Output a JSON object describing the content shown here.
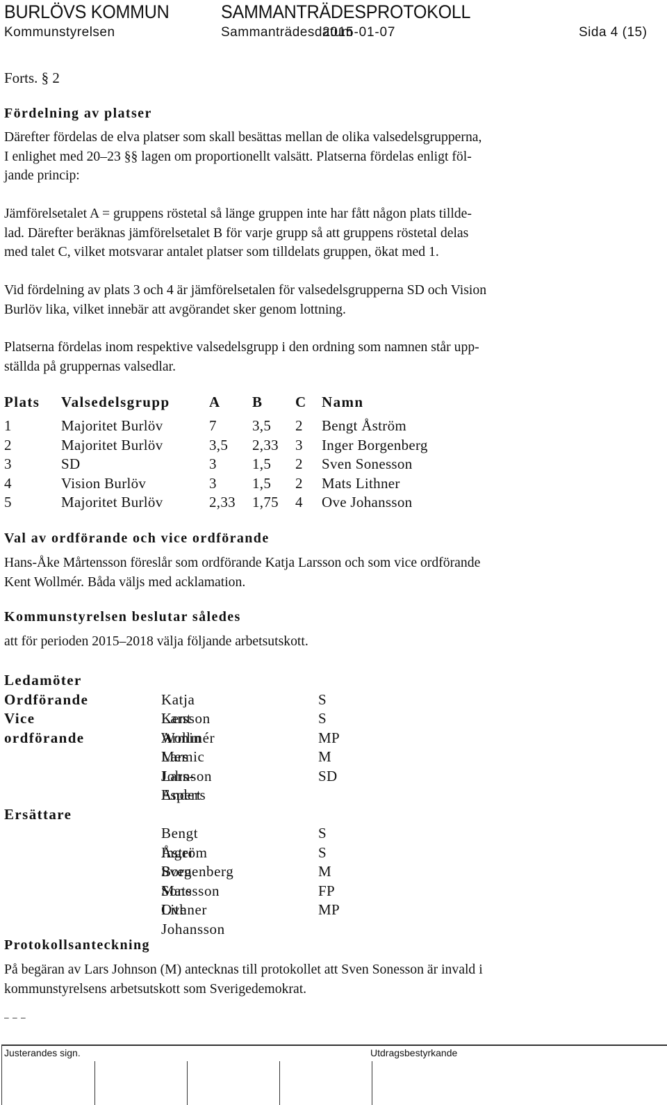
{
  "header": {
    "organization": "BURLÖVS KOMMUN",
    "document_type": "SAMMANTRÄDESPROTOKOLL",
    "body": "Kommunstyrelsen",
    "date_label": "Sammanträdesdatum",
    "date": "2015-01-07",
    "page": "Sida 4 (15)"
  },
  "continuation": "Forts. § 2",
  "sections": {
    "distribution": {
      "heading": "Fördelning av platser",
      "para1_lines": [
        "Därefter fördelas de elva platser som skall besättas mellan de olika valsedelsgrupperna,",
        "I enlighet med 20–23 §§ lagen om proportionellt valsätt. Platserna fördelas enligt föl-",
        "jande princip:"
      ],
      "para2_lines": [
        "Jämförelsetalet A = gruppens röstetal så länge gruppen inte har fått någon plats tillde-",
        "lad. Därefter beräknas jämförelsetalet B för varje grupp så att gruppens röstetal delas",
        "med talet C, vilket motsvarar antalet platser som tilldelats gruppen, ökat med 1."
      ],
      "para3_lines": [
        "Vid fördelning av plats 3 och 4 är jämförelsetalen för valsedelsgrupperna SD och Vision",
        "Burlöv lika, vilket innebär att avgörandet sker genom lottning."
      ],
      "para4_lines": [
        "Platserna fördelas inom respektive valsedelsgrupp i den ordning som namnen står upp-",
        "ställda på gruppernas valsedlar."
      ]
    },
    "seat_table": {
      "columns": [
        "Plats",
        "Valsedelsgrupp",
        "A",
        "B",
        "C",
        "Namn"
      ],
      "rows": [
        [
          "1",
          "Majoritet Burlöv",
          "7",
          "3,5",
          "2",
          "Bengt Åström"
        ],
        [
          "2",
          "Majoritet Burlöv",
          "3,5",
          "2,33",
          "3",
          "Inger Borgenberg"
        ],
        [
          "3",
          "SD",
          "3",
          "1,5",
          "2",
          "Sven Sonesson"
        ],
        [
          "4",
          "Vision Burlöv",
          "3",
          "1,5",
          "2",
          "Mats Lithner"
        ],
        [
          "5",
          "Majoritet Burlöv",
          "2,33",
          "1,75",
          "4",
          "Ove Johansson"
        ]
      ]
    },
    "election": {
      "heading": "Val av ordförande och vice ordförande",
      "lines": [
        "Hans-Åke Mårtensson föreslår som ordförande Katja Larsson och som vice ordförande",
        "Kent Wollmér. Båda väljs med acklamation."
      ]
    },
    "decision": {
      "heading": "Kommunstyrelsen beslutar således",
      "text": "att för perioden 2015–2018 välja följande arbetsutskott."
    },
    "roster": {
      "members_heading": "Ledamöter",
      "members": [
        {
          "role": "Ordförande",
          "name": "Katja Larsson",
          "party": "S"
        },
        {
          "role": "Vice ordförande",
          "name": "Kent Wollmér",
          "party": "S"
        },
        {
          "role": "",
          "name": "Armin Memic",
          "party": "MP"
        },
        {
          "role": "",
          "name": "Lars Johnson",
          "party": "M"
        },
        {
          "role": "",
          "name": "Lars-Anders",
          "party": "SD"
        },
        {
          "role": "",
          "name": "Espert",
          "party": ""
        }
      ],
      "substitutes_heading": "Ersättare",
      "substitutes": [
        {
          "name": "Bengt Åström",
          "party": "S"
        },
        {
          "name": "Inger Borgenberg",
          "party": "S"
        },
        {
          "name": "Sven Sonesson",
          "party": "M"
        },
        {
          "name": "Mats Lithner",
          "party": "FP"
        },
        {
          "name": "Ove Johansson",
          "party": "MP"
        }
      ]
    },
    "note": {
      "heading": "Protokollsanteckning",
      "lines": [
        "På begäran av Lars Johnson (M) antecknas till protokollet att Sven Sonesson är invald i",
        "kommunstyrelsens arbetsutskott som Sverigedemokrat."
      ]
    }
  },
  "end_marker": "– – –",
  "footer": {
    "signature_label": "Justerandes sign.",
    "certification_label": "Utdragsbestyrkande"
  }
}
